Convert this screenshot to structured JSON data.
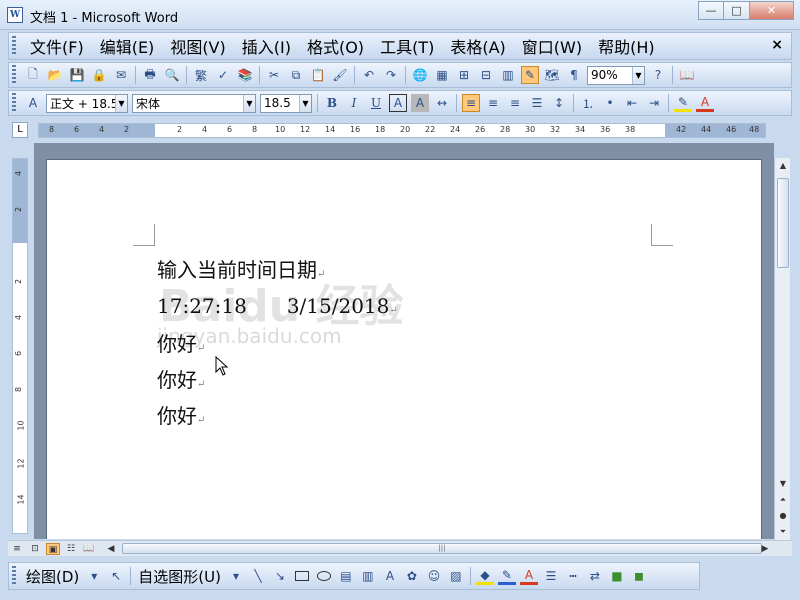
{
  "window": {
    "title": "文档 1 - Microsoft Word",
    "icon_name": "word-doc-icon",
    "buttons": {
      "minimize": "—",
      "maximize": "□",
      "close": "✕"
    }
  },
  "menubar": {
    "items": [
      "文件(F)",
      "编辑(E)",
      "视图(V)",
      "插入(I)",
      "格式(O)",
      "工具(T)",
      "表格(A)",
      "窗口(W)",
      "帮助(H)"
    ],
    "close": "×"
  },
  "standard_toolbar": {
    "traditional_chinese": "繁",
    "zoom": "90%"
  },
  "formatting_toolbar": {
    "style": "正文 + 18.5",
    "font": "宋体",
    "size": "18.5",
    "bold": "B",
    "italic": "I",
    "underline": "U",
    "char_border": "A",
    "char_shading": "A",
    "font_color": "A"
  },
  "ruler": {
    "horizontal_ticks": [
      "8",
      "6",
      "4",
      "2",
      "2",
      "4",
      "6",
      "8",
      "10",
      "12",
      "14",
      "16",
      "18",
      "20",
      "22",
      "24",
      "26",
      "28",
      "30",
      "32",
      "34",
      "36",
      "38",
      "42",
      "44",
      "46",
      "48"
    ],
    "vertical_ticks": [
      "4",
      "2",
      "2",
      "4",
      "6",
      "8",
      "10",
      "12",
      "14"
    ]
  },
  "document": {
    "lines": [
      "输入当前时间日期",
      "17:27:18　　3/15/2018",
      "你好",
      "你好",
      "你好"
    ],
    "paragraph_mark": "↵",
    "watermark": "Baidu 经验",
    "watermark_url": "jingyan.baidu.com"
  },
  "scrollbar": {
    "grip": "|||"
  },
  "drawing_toolbar": {
    "draw": "绘图(D)",
    "autoshapes": "自选图形(U)"
  },
  "colors": {
    "toolbar_bg": "#c9daf0",
    "highlight": "#ffc87a",
    "doc_background": "#7f8fa6",
    "font_color": "#d83a1e",
    "line_color": "#2b5fd0",
    "highlight_color": "#f2e200"
  }
}
